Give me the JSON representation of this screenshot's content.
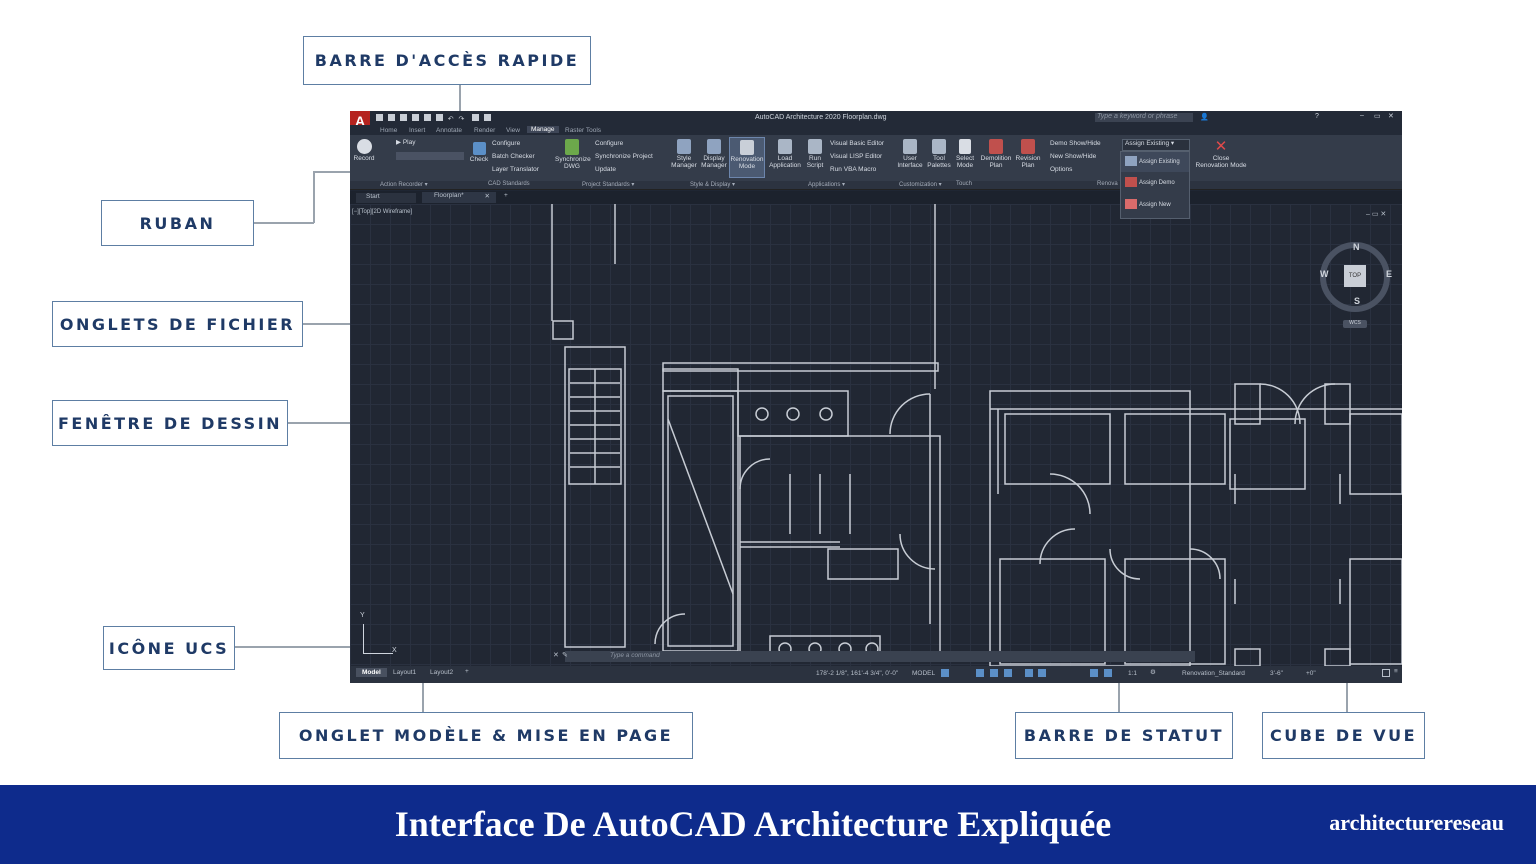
{
  "callouts": {
    "quick_access": "BARRE D'ACCÈS RAPIDE",
    "ribbon": "RUBAN",
    "file_tabs": "ONGLETS DE FICHIER",
    "drawing_window": "FENÊTRE DE DESSIN",
    "ucs_icon": "ICÔNE UCS",
    "layout_tabs": "ONGLET MODÈLE & MISE EN PAGE",
    "status_bar": "BARRE DE STATUT",
    "view_cube": "CUBE DE VUE"
  },
  "app": {
    "logo": "A",
    "window_title": "AutoCAD Architecture 2020   Floorplan.dwg",
    "search_placeholder": "Type a keyword or phrase",
    "menu_tabs": [
      "Home",
      "Insert",
      "Annotate",
      "Render",
      "View",
      "Manage",
      "Raster Tools"
    ],
    "active_tab": "Manage"
  },
  "ribbon": {
    "record": "Record",
    "play": "Play",
    "check": "Check",
    "configure": "Configure",
    "batch_checker": "Batch Checker",
    "layer_translator": "Layer Translator",
    "synchronize": "Synchronize",
    "dwg": "DWG",
    "configure2": "Configure",
    "sync_project": "Synchronize Project",
    "update": "Update",
    "style": "Style",
    "manager": "Manager",
    "display": "Display",
    "manager2": "Manager",
    "renovation": "Renovation",
    "mode": "Mode",
    "load": "Load",
    "application": "Application",
    "run": "Run",
    "script": "Script",
    "vb_editor": "Visual Basic Editor",
    "lisp_editor": "Visual LISP Editor",
    "run_vba": "Run VBA Macro",
    "user": "User",
    "interface": "Interface",
    "tool": "Tool",
    "palettes": "Palettes",
    "select": "Select",
    "mode2": "Mode",
    "demolition": "Demolition",
    "plan": "Plan",
    "revision": "Revision",
    "plan2": "Plan",
    "demo_showhide": "Demo Show/Hide",
    "new_showhide": "New Show/Hide",
    "options": "Options",
    "assign_existing_dd": "Assign Existing",
    "assign_existing": "Assign Existing",
    "assign_demo": "Assign Demo",
    "assign_new": "Assign New",
    "close": "Close",
    "renovation_mode": "Renovation Mode",
    "panels": [
      "Action Recorder ▾",
      "CAD Standards",
      "Project Standards ▾",
      "Style & Display ▾",
      "Applications ▾",
      "Customization ▾",
      "Touch",
      "Renova"
    ]
  },
  "file_tabs": {
    "start": "Start",
    "floorplan": "Floorplan*",
    "add": "+"
  },
  "viewport": {
    "label": "[−][Top][2D Wireframe]",
    "ucs_y": "Y",
    "ucs_x": "X"
  },
  "viewcube": {
    "n": "N",
    "s": "S",
    "e": "E",
    "w": "W",
    "top": "TOP",
    "wcs": "WCS"
  },
  "command_line": {
    "placeholder": "Type a command"
  },
  "layout_tabs": [
    "Model",
    "Layout1",
    "Layout2",
    "+"
  ],
  "status": {
    "coords": "178'-2 1/8\", 161'-4 3/4\", 0'-0\"",
    "model": "MODEL",
    "scale": "1:1",
    "renovation_style": "Renovation_Standard",
    "dim": "3'-6\"",
    "elev": "+0\""
  },
  "footer": {
    "title": "Interface De AutoCAD Architecture Expliquée",
    "brand": "architecturereseau"
  }
}
